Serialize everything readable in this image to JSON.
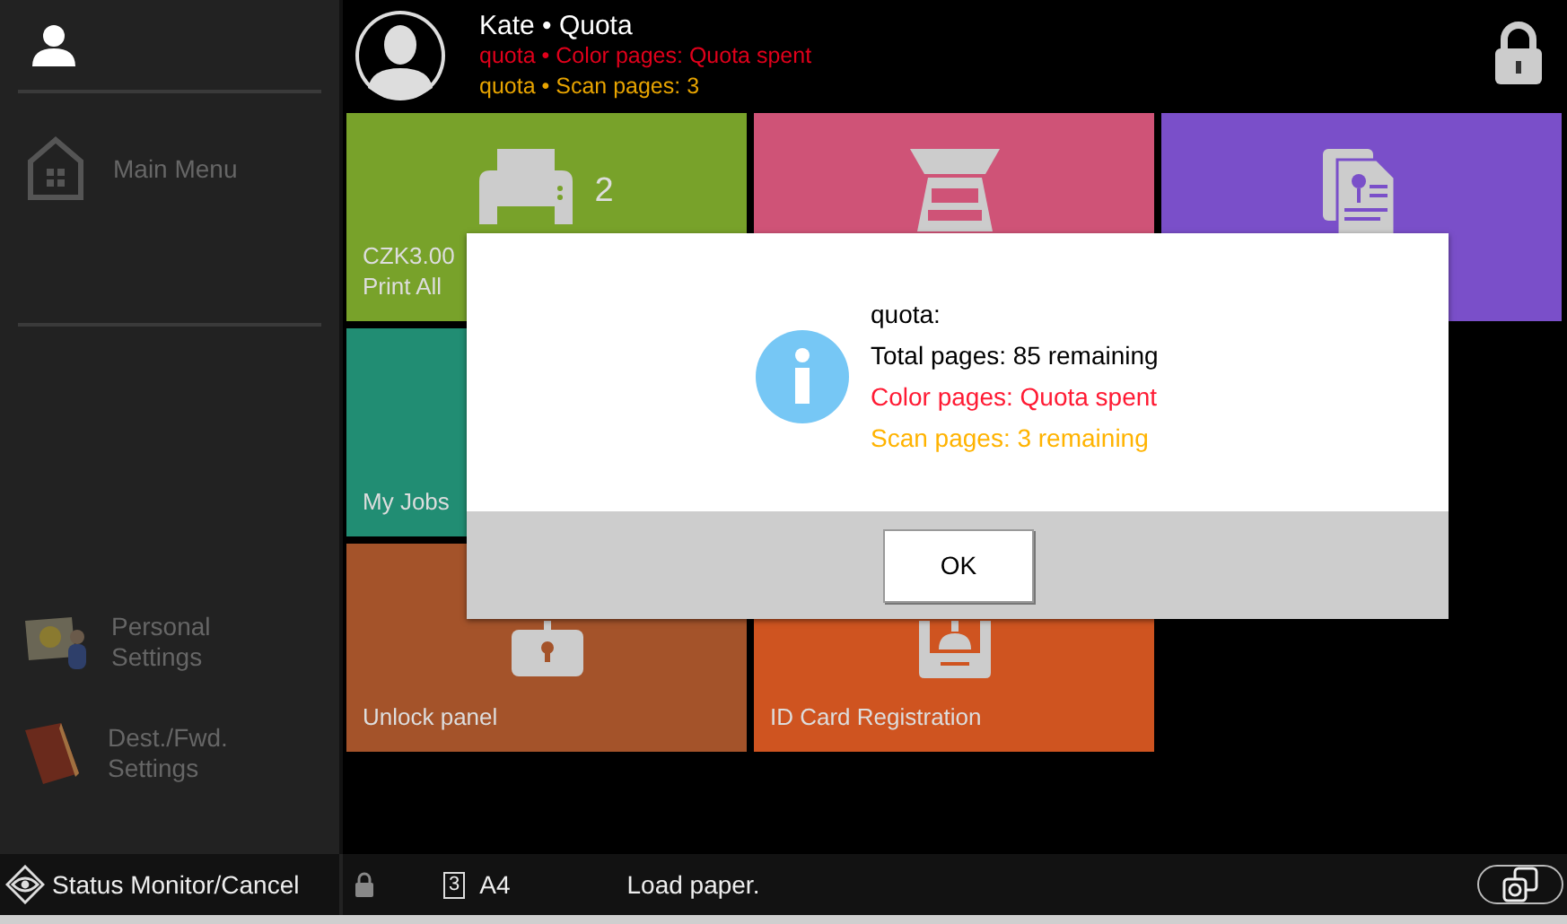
{
  "sidebar": {
    "items": [
      {
        "label": "Main Menu",
        "kind": "home"
      },
      {
        "label": "Personal Settings",
        "kind": "personal"
      },
      {
        "label": "Dest./Fwd. Settings",
        "kind": "book"
      }
    ]
  },
  "header": {
    "title": "Kate • Quota",
    "lines": [
      {
        "text": "quota • Color pages: Quota spent",
        "color": "#e0001b"
      },
      {
        "text": "quota • Scan pages: 3",
        "color": "#e8a400"
      }
    ]
  },
  "tiles": [
    {
      "kind": "print",
      "color": "#78a22a",
      "badge": "2",
      "lines": [
        "CZK3.00",
        "Print All"
      ]
    },
    {
      "kind": "scan",
      "color": "#cf5377"
    },
    {
      "kind": "document",
      "color": "#7a4fc9"
    },
    {
      "kind": "jobs",
      "color": "#218d73",
      "lines": [
        "My Jobs"
      ]
    },
    {
      "kind": "hidden"
    },
    {
      "kind": "empty"
    },
    {
      "kind": "unlock",
      "color": "#a4532a",
      "lines": [
        "Unlock panel"
      ]
    },
    {
      "kind": "idcard",
      "color": "#cf5420",
      "lines": [
        "ID Card Registration"
      ]
    }
  ],
  "dialog": {
    "lines": [
      {
        "text": "quota:",
        "color": "#000000"
      },
      {
        "text": "Total pages: 85 remaining",
        "color": "#000000"
      },
      {
        "text": "Color pages: Quota spent",
        "color": "#ff1a33"
      },
      {
        "text": "Scan pages: 3 remaining",
        "color": "#ffb300"
      }
    ],
    "button": "OK"
  },
  "status_bar": {
    "monitor": "Status Monitor/Cancel",
    "tray": "3",
    "paper": "A4",
    "message": "Load paper."
  }
}
